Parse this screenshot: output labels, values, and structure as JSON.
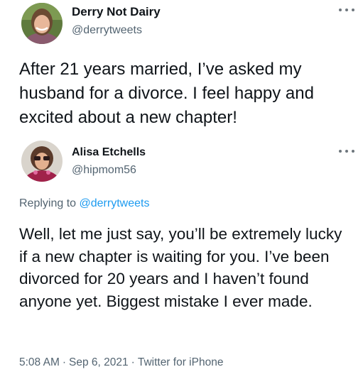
{
  "original_tweet": {
    "display_name": "Derry Not Dairy",
    "handle": "@derrytweets",
    "avatar_icon": "profile-photo-icon",
    "text": "After 21 years married, I’ve asked my husband for a divorce. I feel happy and excited about a new chapter!"
  },
  "reply_tweet": {
    "display_name": "Alisa Etchells",
    "handle": "@hipmom56",
    "avatar_icon": "profile-photo-icon",
    "replying_prefix": "Replying to",
    "replying_to": "@derrytweets",
    "text": "Well, let me just say, you’ll be extremely lucky if a new chapter is waiting for you. I’ve been divorced for 20 years and I haven’t found anyone yet. Biggest mistake I ever made.",
    "time": "5:08 AM",
    "date": "Sep 6, 2021",
    "source": "Twitter for iPhone",
    "separator": "·"
  },
  "icons": {
    "more": "more-options-icon"
  },
  "colors": {
    "text": "#0f1419",
    "secondary": "#536471",
    "link": "#1d9bf0"
  }
}
